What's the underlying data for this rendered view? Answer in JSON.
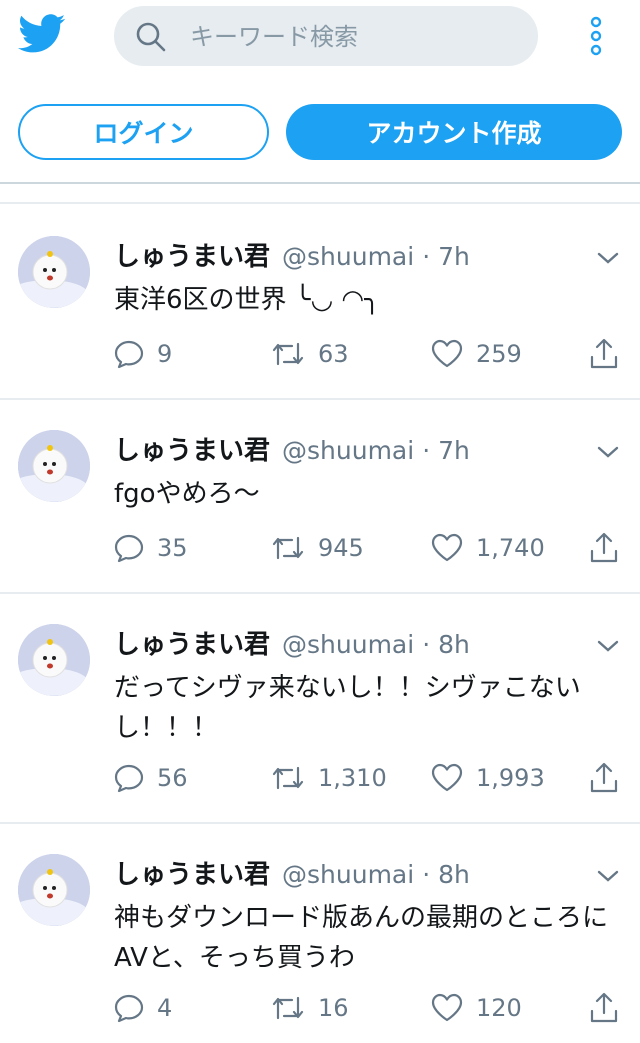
{
  "header": {
    "search_placeholder": "キーワード検索"
  },
  "auth": {
    "login_label": "ログイン",
    "signup_label": "アカウント作成"
  },
  "colors": {
    "accent": "#1da1f2",
    "text": "#14171a",
    "muted": "#657786"
  },
  "icons": [
    "twitter-bird-icon",
    "search-icon",
    "more-vertical-icon",
    "chevron-down-icon",
    "reply-icon",
    "retweet-icon",
    "like-icon",
    "share-icon"
  ],
  "tweets": [
    {
      "name": "しゅうまい君",
      "handle": "@shuumai",
      "sep": "·",
      "time": "7h",
      "text": "東洋6区の世界 ╰◡ ◠╮",
      "replies": "9",
      "retweets": "63",
      "likes": "259"
    },
    {
      "name": "しゅうまい君",
      "handle": "@shuumai",
      "sep": "·",
      "time": "7h",
      "text": "fgoやめろ〜",
      "replies": "35",
      "retweets": "945",
      "likes": "1,740"
    },
    {
      "name": "しゅうまい君",
      "handle": "@shuumai",
      "sep": "·",
      "time": "8h",
      "text": "だってシヴァ来ないし！！シヴァこないし！！！",
      "replies": "56",
      "retweets": "1,310",
      "likes": "1,993"
    },
    {
      "name": "しゅうまい君",
      "handle": "@shuumai",
      "sep": "·",
      "time": "8h",
      "text": "神もダウンロード版あんの最期のところにAVと、そっち買うわ",
      "replies": "4",
      "retweets": "16",
      "likes": "120"
    }
  ]
}
